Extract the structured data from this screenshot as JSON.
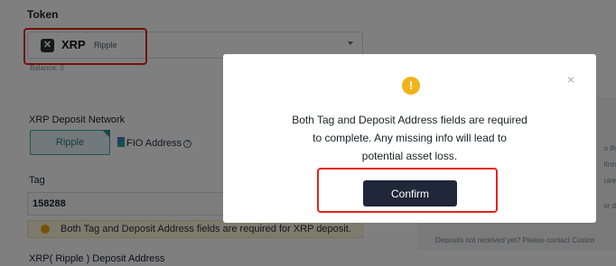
{
  "token": {
    "title": "Token",
    "symbol": "XRP",
    "name": "Ripple",
    "icon_glyph": "✕",
    "balance": "Balance: 0"
  },
  "network": {
    "title": "XRP Deposit Network",
    "options": [
      "Ripple",
      "FIO Address"
    ],
    "selected": "Ripple",
    "info_glyph": "?"
  },
  "tag": {
    "title": "Tag",
    "value": "158288",
    "warning": "Both Tag and Deposit Address fields are required for XRP deposit."
  },
  "address": {
    "title": "XRP( Ripple ) Deposit Address"
  },
  "side": {
    "fragments": [
      "o th",
      "firm",
      "uire",
      "or d"
    ],
    "deposits_note": "Deposits not received yet? Please contact Custon"
  },
  "modal": {
    "icon_glyph": "!",
    "close_glyph": "×",
    "lines": [
      "Both Tag and Deposit Address fields are required",
      "to complete. Any missing info will lead to",
      "potential asset loss."
    ],
    "confirm_label": "Confirm"
  },
  "colors": {
    "highlight": "#e5231b",
    "warning": "#f2b21a",
    "accent": "#3aa6b0",
    "button": "#1f2738"
  }
}
